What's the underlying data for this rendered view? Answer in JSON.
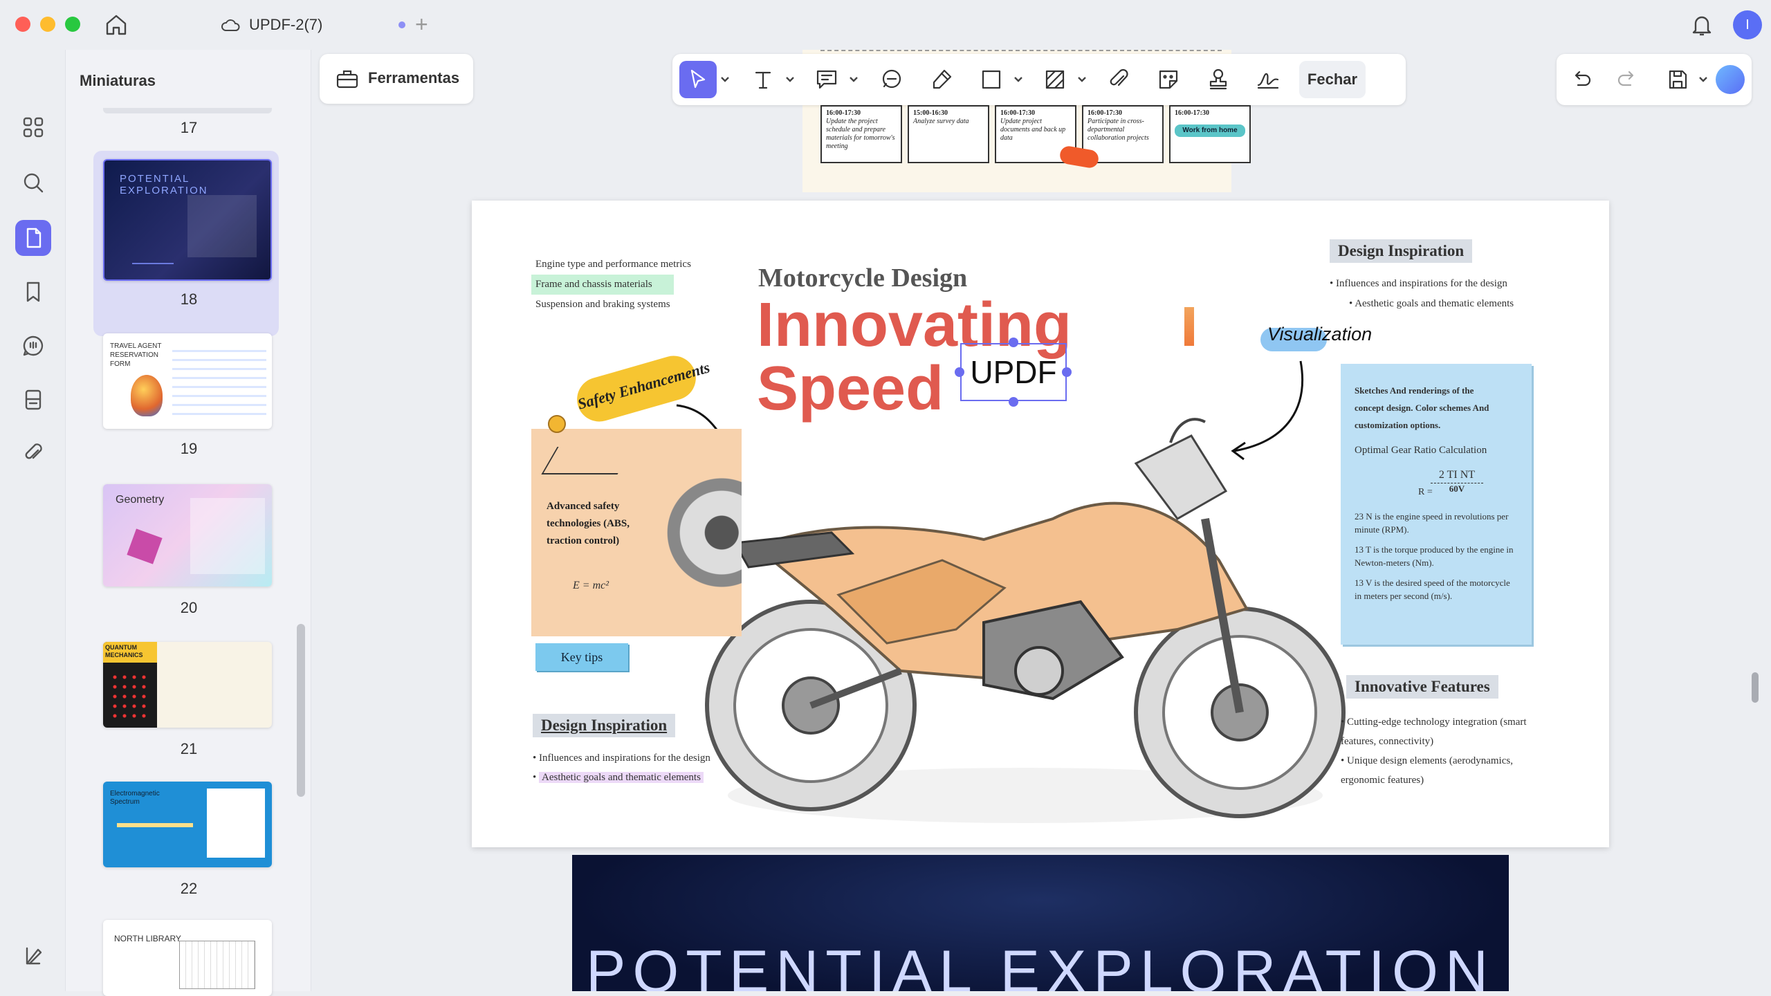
{
  "window": {
    "tab_title": "UPDF-2(7)",
    "avatar_initial": "I"
  },
  "sidebar": {
    "panel_title": "Miniaturas"
  },
  "thumbnails": [
    {
      "page": "17"
    },
    {
      "page": "18",
      "title": "POTENTIAL EXPLORATION"
    },
    {
      "page": "19",
      "title": "TRAVEL AGENT RESERVATION FORM"
    },
    {
      "page": "20",
      "title": "Geometry"
    },
    {
      "page": "21",
      "title": "QUANTUM MECHANICS"
    },
    {
      "page": "22",
      "title": "Electromagnetic Spectrum"
    },
    {
      "page": "",
      "title": "NORTH LIBRARY"
    }
  ],
  "toolbar": {
    "tools_label": "Ferramentas",
    "close_label": "Fechar"
  },
  "prev_page": {
    "cells": [
      {
        "time": "16:00-17:30",
        "text": "Update the project schedule and prepare materials for tomorrow's meeting"
      },
      {
        "time": "15:00-16:30",
        "text": "Analyze survey data"
      },
      {
        "time": "16:00-17:30",
        "text": "Update project documents and back up data"
      },
      {
        "time": "16:00-17:30",
        "text": "Participate in cross-departmental collaboration projects"
      },
      {
        "time": "16:00-17:30",
        "text": "Work from home"
      }
    ]
  },
  "doc": {
    "list_top": [
      "Engine type and performance metrics",
      "Frame and chassis materials",
      "Suspension and braking systems"
    ],
    "heading": "Motorcycle Design",
    "title_line1": "Innovating",
    "title_line2": "Speed",
    "textbox": "UPDF",
    "sticker": "Safety Enhancements",
    "visualization": "Visualization",
    "note_card": "Advanced safety technologies (ABS, traction control)",
    "note_formula": "E = mc²",
    "key_tips": "Key tips",
    "design_inspiration_right": {
      "title": "Design Inspiration",
      "items": [
        "Influences and inspirations for the design",
        "Aesthetic goals and thematic elements"
      ]
    },
    "blue_box": {
      "intro": "Sketches And renderings of the concept design. Color schemes And customization options.",
      "subtitle": "Optimal Gear Ratio Calculation",
      "formula_top": "2 TI NT",
      "formula_left": "R =",
      "formula_bottom": "60V",
      "notes": [
        "23 N is the engine speed in revolutions per minute (RPM).",
        "13 T is the torque produced by the engine in Newton-meters (Nm).",
        "13 V is the desired speed of the motorcycle in meters per second (m/s)."
      ]
    },
    "design_inspiration_left": {
      "title": "Design Inspiration",
      "items": [
        "Influences and inspirations for the design",
        "Aesthetic goals and thematic elements"
      ]
    },
    "innovative_features": {
      "title": "Innovative Features",
      "items": [
        "Cutting-edge technology integration (smart features, connectivity)",
        "Unique design elements (aerodynamics, ergonomic features)"
      ]
    }
  },
  "next_page": {
    "title": "POTENTIAL EXPLORATION"
  },
  "colors": {
    "accent": "#6a6cf0",
    "title_red": "#e05a4f",
    "blue_box": "#bde0f5",
    "highlight_green": "#c8f2d8",
    "highlight_purple": "#ecd9f7"
  }
}
